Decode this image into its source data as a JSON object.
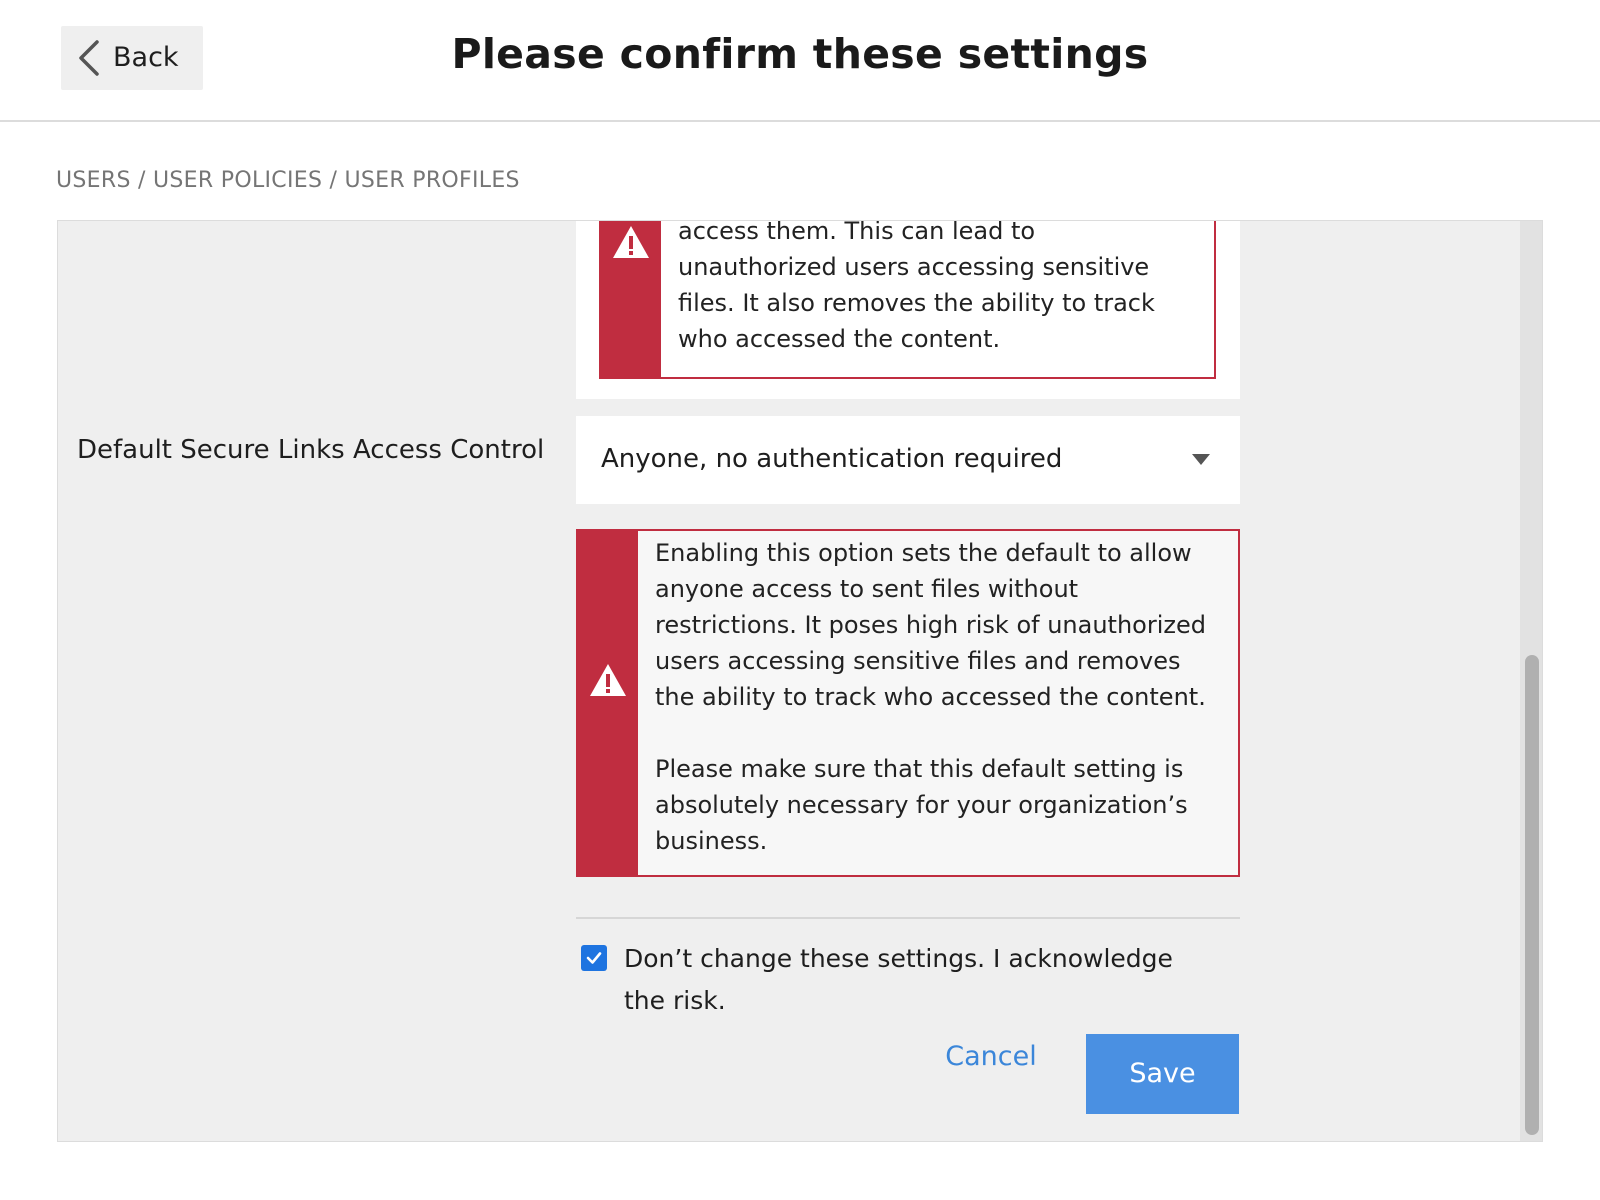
{
  "header": {
    "back_label": "Back",
    "title": "Please confirm these settings"
  },
  "breadcrumb": "USERS / USER POLICIES / USER PROFILES",
  "previous_warning": {
    "icon": "warning-triangle-icon",
    "text": "access them. This can lead to\nunauthorized users accessing sensitive\nfiles. It also removes the ability to track\nwho accessed the content."
  },
  "field": {
    "label": "Default Secure Links Access Control",
    "selected_value": "Anyone, no authentication required"
  },
  "warning": {
    "icon": "warning-triangle-icon",
    "text": "Enabling this option sets the default to allow\nanyone access to sent files without\nrestrictions. It poses high risk of unauthorized\nusers accessing sensitive files and removes\nthe ability to track who accessed the content.\n\nPlease make sure that this default setting is\nabsolutely necessary for your organization’s\nbusiness."
  },
  "acknowledge": {
    "checked": true,
    "label": "Don’t change these settings. I acknowledge the risk."
  },
  "actions": {
    "cancel_label": "Cancel",
    "save_label": "Save"
  },
  "colors": {
    "warning_red": "#c02d40",
    "primary_blue": "#4a90e2",
    "link_blue": "#3b86d9",
    "checkbox_blue": "#1e74e0",
    "panel_bg": "#efefef"
  }
}
